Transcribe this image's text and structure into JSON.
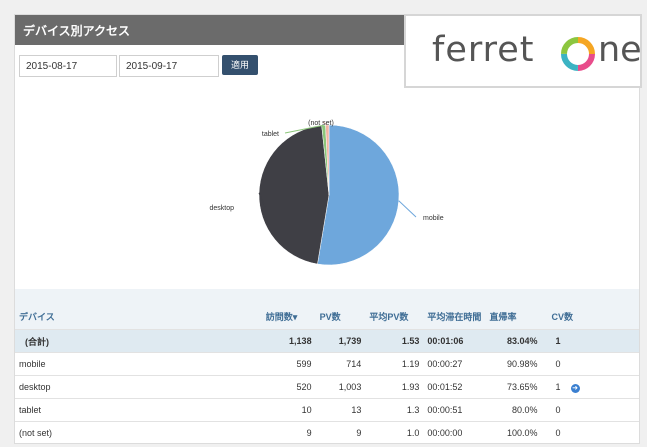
{
  "title": "デバイス別アクセス",
  "date_from": "2015-08-17",
  "date_to": "2015-09-17",
  "apply_label": "適用",
  "logo": {
    "text_left": "ferret",
    "text_right": "ne",
    "ring_colors": [
      "#f5a623",
      "#e84c8b",
      "#3bb3c3",
      "#8cc63f"
    ]
  },
  "chart_data": {
    "type": "pie",
    "slices": [
      {
        "label": "mobile",
        "value": 599,
        "color": "#6ea7dc"
      },
      {
        "label": "desktop",
        "value": 520,
        "color": "#3f3f45"
      },
      {
        "label": "tablet",
        "value": 10,
        "color": "#8cc67a"
      },
      {
        "label": "(not set)",
        "value": 9,
        "color": "#f2b3a3"
      }
    ]
  },
  "table": {
    "headers": [
      "デバイス",
      "訪問数▾",
      "PV数",
      "平均PV数",
      "平均滞在時間",
      "直帰率",
      "CV数"
    ],
    "rows": [
      [
        "(合計)",
        "1,138",
        "1,739",
        "1.53",
        "00:01:06",
        "83.04%",
        "1"
      ],
      [
        "mobile",
        "599",
        "714",
        "1.19",
        "00:00:27",
        "90.98%",
        "0"
      ],
      [
        "desktop",
        "520",
        "1,003",
        "1.93",
        "00:01:52",
        "73.65%",
        "1"
      ],
      [
        "tablet",
        "10",
        "13",
        "1.3",
        "00:00:51",
        "80.0%",
        "0"
      ],
      [
        "(not set)",
        "9",
        "9",
        "1.0",
        "00:00:00",
        "100.0%",
        "0"
      ]
    ]
  }
}
